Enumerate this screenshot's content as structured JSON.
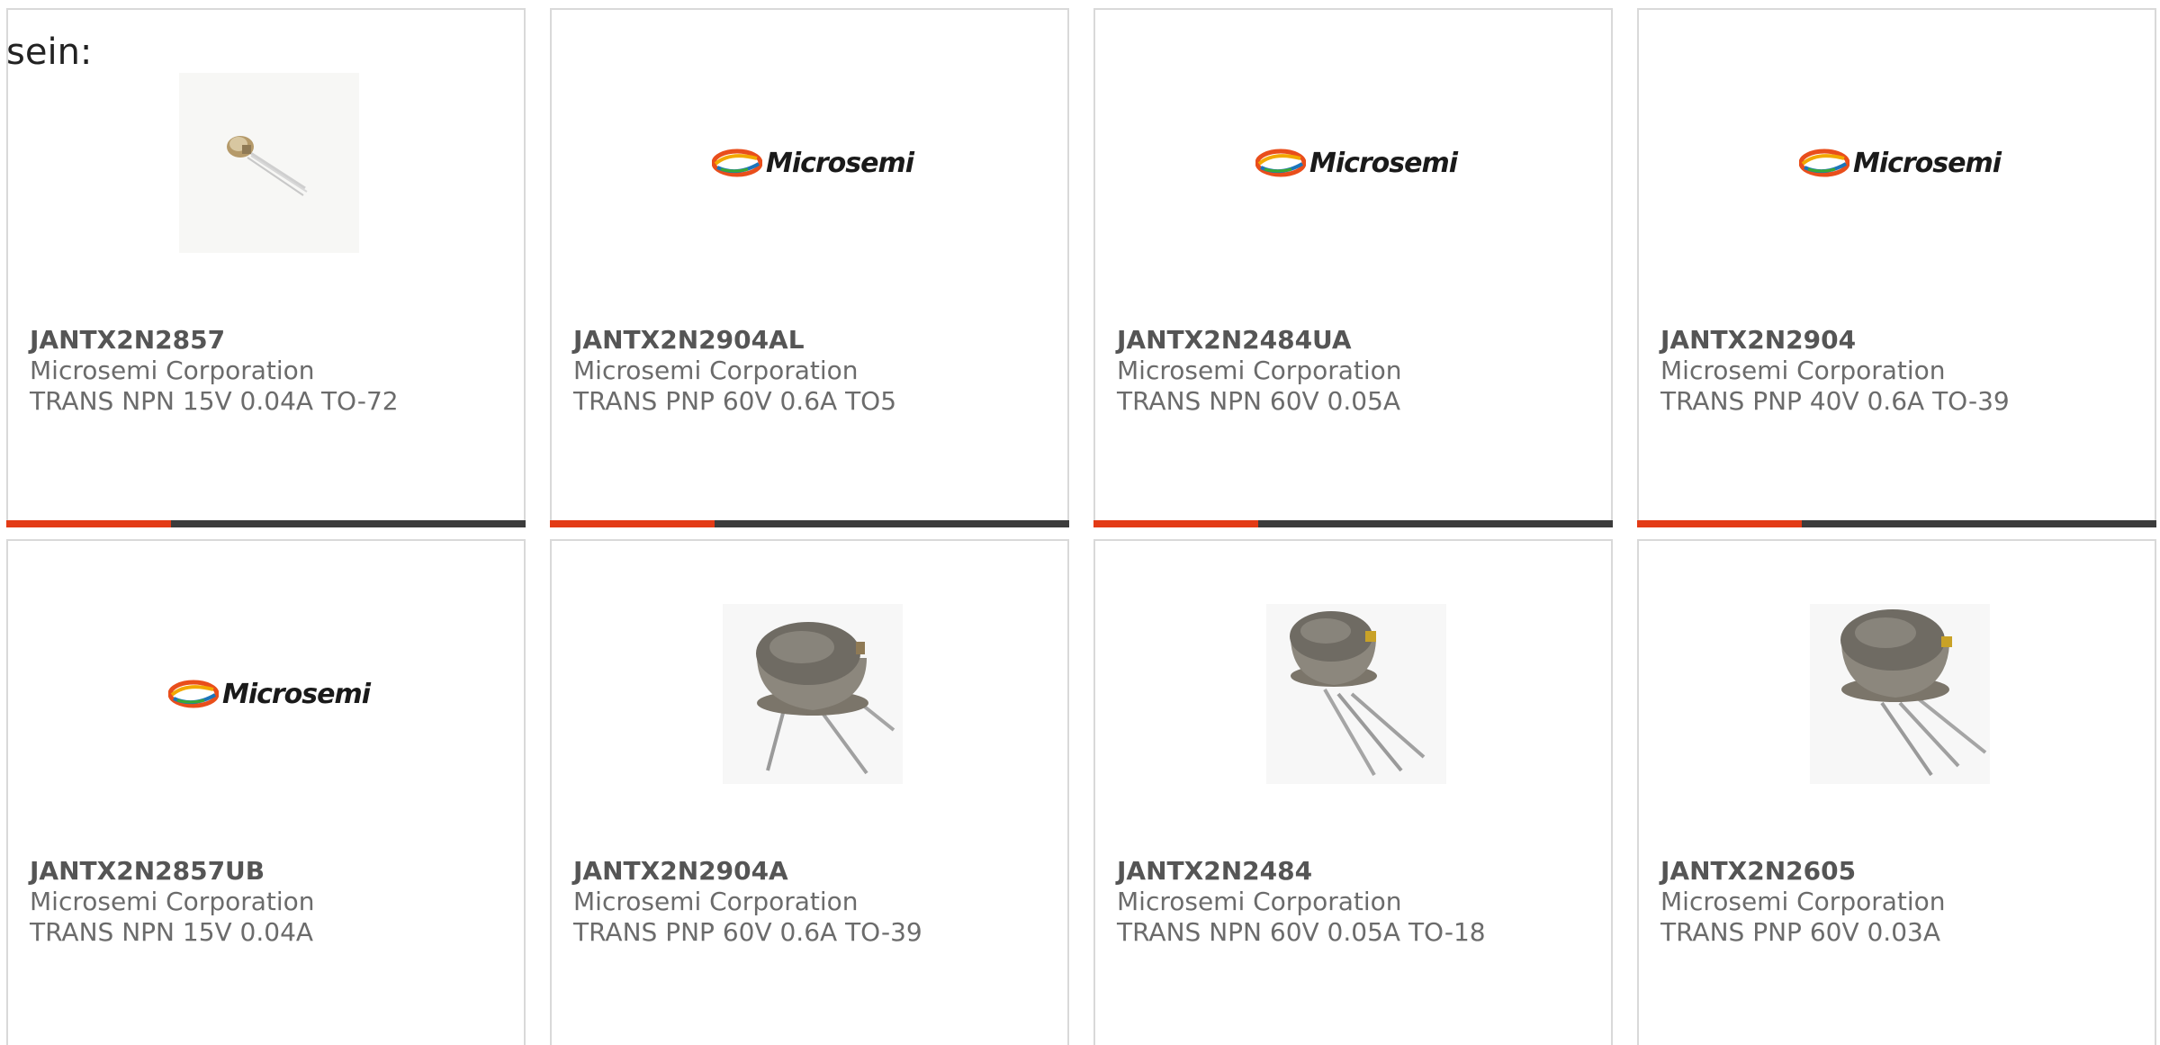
{
  "lead_text": "sein:",
  "products": [
    {
      "part": "JANTX2N2857",
      "maker": "Microsemi Corporation",
      "desc": "TRANS NPN 15V 0.04A TO-72",
      "image": "small-transistor-photo",
      "logo_text": ""
    },
    {
      "part": "JANTX2N2904AL",
      "maker": "Microsemi Corporation",
      "desc": "TRANS PNP 60V 0.6A TO5",
      "image": "microsemi-logo",
      "logo_text": "Microsemi"
    },
    {
      "part": "JANTX2N2484UA",
      "maker": "Microsemi Corporation",
      "desc": "TRANS NPN 60V 0.05A",
      "image": "microsemi-logo",
      "logo_text": "Microsemi"
    },
    {
      "part": "JANTX2N2904",
      "maker": "Microsemi Corporation",
      "desc": "TRANS PNP 40V 0.6A TO-39",
      "image": "microsemi-logo",
      "logo_text": "Microsemi"
    },
    {
      "part": "JANTX2N2857UB",
      "maker": "Microsemi Corporation",
      "desc": "TRANS NPN 15V 0.04A",
      "image": "microsemi-logo",
      "logo_text": "Microsemi"
    },
    {
      "part": "JANTX2N2904A",
      "maker": "Microsemi Corporation",
      "desc": "TRANS PNP 60V 0.6A TO-39",
      "image": "metal-can-transistor-photo",
      "logo_text": ""
    },
    {
      "part": "JANTX2N2484",
      "maker": "Microsemi Corporation",
      "desc": "TRANS NPN 60V 0.05A TO-18",
      "image": "metal-can-transistor-photo",
      "logo_text": ""
    },
    {
      "part": "JANTX2N2605",
      "maker": "Microsemi Corporation",
      "desc": "TRANS PNP 60V 0.03A",
      "image": "metal-can-transistor-photo",
      "logo_text": ""
    }
  ],
  "colors": {
    "accent_bar": "#e33b16",
    "bar_rest": "#3c3c3c",
    "card_border": "#d9d9d9",
    "text": "#6b6b6b"
  }
}
